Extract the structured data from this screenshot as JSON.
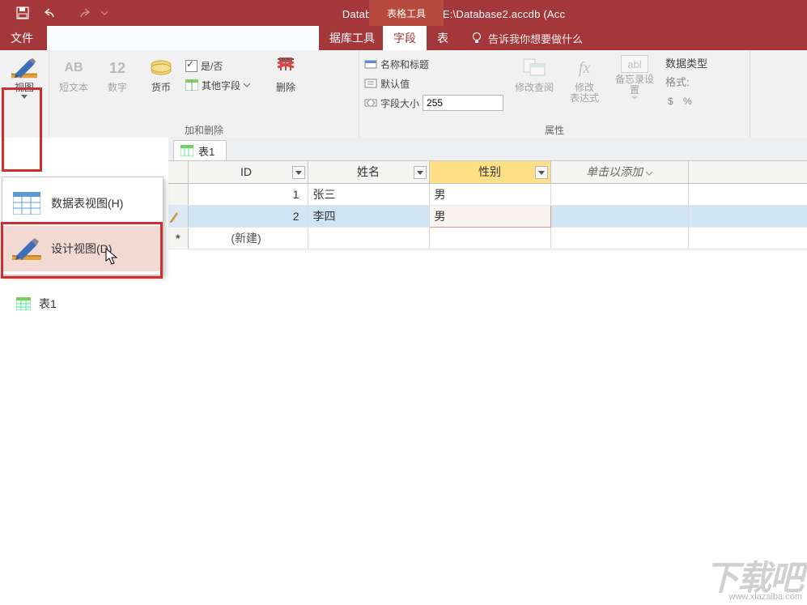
{
  "title": "Database2 : 数据库- E:\\Database2.accdb (Acc",
  "tool_context": "表格工具",
  "tabs": {
    "file": "文件",
    "dbtools": "据库工具",
    "fields": "字段",
    "table": "表",
    "tell": "告诉我你想要做什么"
  },
  "ribbon": {
    "view": "视图",
    "short_text": "短文本",
    "number": "数字",
    "currency": "货币",
    "yes_no": "是/否",
    "other_fields": "其他字段",
    "delete": "删除",
    "name_title": "名称和标题",
    "default_value": "默认值",
    "field_size": "字段大小",
    "field_size_val": "255",
    "modify_lookup1": "修改查阅",
    "modify_expr1": "修改",
    "modify_expr2": "表达式",
    "memo": "备忘录设置",
    "data_type_lbl": "数据类型",
    "format_lbl": "格式:",
    "percent": "%",
    "grp_add_delete": "加和删除",
    "grp_properties": "属性"
  },
  "view_menu": {
    "datasheet": "数据表视图(H)",
    "design": "设计视图(D)"
  },
  "nav": {
    "table1": "表1"
  },
  "doc": {
    "tab": "表1",
    "cols": {
      "id": "ID",
      "name": "姓名",
      "gender": "性别",
      "add": "单击以添加"
    },
    "rows": [
      {
        "id": "1",
        "name": "张三",
        "gender": "男"
      },
      {
        "id": "2",
        "name": "李四",
        "gender": "男"
      }
    ],
    "new_label": "(新建)"
  },
  "watermark": {
    "big": "下载吧",
    "small": "www.xiazaiba.com"
  },
  "icons": {
    "currency": "$",
    "number": "12",
    "short_text": "AB",
    "fx": "fx",
    "abl": "abl"
  }
}
